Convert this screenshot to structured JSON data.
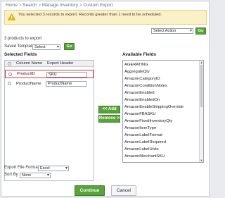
{
  "breadcrumb": {
    "home": "Home",
    "search": "Search",
    "manage": "Manage Inventory",
    "current": "Custom Export",
    "separator": ">"
  },
  "alert": {
    "message": "You selected 3 records to export. Records greater than 1 need to be scheduled."
  },
  "top_actions": {
    "select_action": "Select Action",
    "go": "Go"
  },
  "products_count": "3 products to export",
  "saved_template": {
    "label": "Saved Template",
    "value": "Select",
    "go": "Go"
  },
  "selected_fields": {
    "heading": "Selected Fields",
    "columns": [
      "Column Name",
      "Export Header"
    ],
    "rows": [
      {
        "column": "ProductID",
        "header": "SKU"
      },
      {
        "column": "ProductName",
        "header": "ProductName"
      }
    ]
  },
  "actions": {
    "add": "<< Add",
    "remove": "Remove >>"
  },
  "available_fields": {
    "heading": "Available Fields",
    "items": [
      "AGERATING",
      "AggregateQty",
      "AmazonCategoryID",
      "AmazonConditionNotes",
      "AmazonEnabled",
      "AmazonEnabledOn",
      "AmazonEnableShippingOverride",
      "AmazonFBASKU",
      "AmazonFixedInventoryQty",
      "AmazonItemType",
      "AmazonLabelFormat",
      "AmazonLabelRequired",
      "AmazonLabelUnits",
      "AmazonMerchantSKU"
    ]
  },
  "export_format": {
    "label": "Export File Format",
    "value": "Excel"
  },
  "sort_by": {
    "label": "Sort By",
    "value": "None"
  },
  "footer": {
    "continue": "Continue",
    "cancel": "Cancel"
  },
  "colors": {
    "accent_green": "#58a43b",
    "alert_bg": "#fbf1c8",
    "highlight_red": "#d8323a"
  }
}
